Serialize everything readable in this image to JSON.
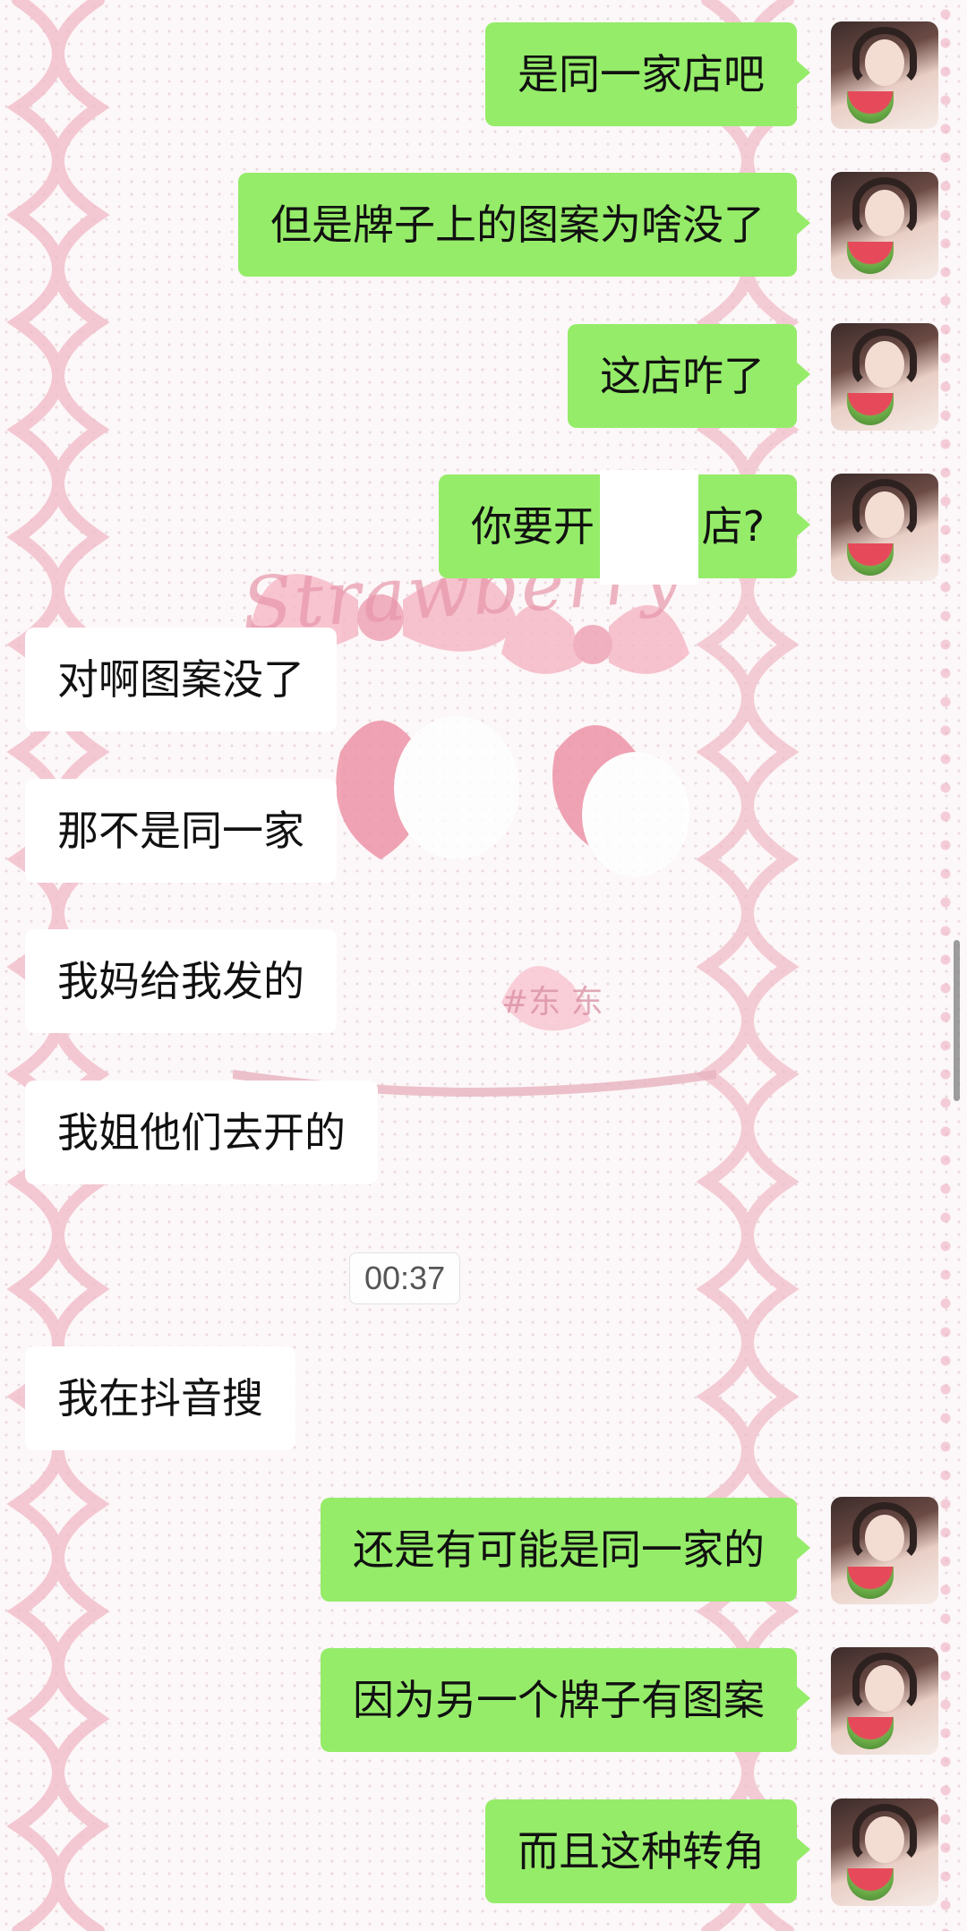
{
  "messages": [
    {
      "side": "out",
      "text": "是同一家店吧"
    },
    {
      "side": "out",
      "text": "但是牌子上的图案为啥没了"
    },
    {
      "side": "out",
      "text": "这店咋了"
    },
    {
      "side": "out",
      "text": "你要开"
    },
    {
      "side": "out",
      "text": "店?"
    },
    {
      "side": "in",
      "text": "对啊图案没了"
    },
    {
      "side": "in",
      "text": "那不是同一家"
    },
    {
      "side": "in",
      "text": "我妈给我发的"
    },
    {
      "side": "in",
      "text": "我姐他们去开的"
    },
    {
      "side": "in",
      "text": "我在抖音搜"
    },
    {
      "side": "out",
      "text": "还是有可能是同一家的"
    },
    {
      "side": "out",
      "text": "因为另一个牌子有图案"
    },
    {
      "side": "out",
      "text": "而且这种转角"
    }
  ],
  "timestamp": "00:37",
  "wallpaper": {
    "watermark": "Strawberry",
    "hashtag": "#东 东"
  },
  "icons": {
    "avatar": "user-avatar-icon"
  },
  "colors": {
    "outgoing_bubble": "#95ec69",
    "incoming_bubble": "#ffffff",
    "background": "#fcf7f8"
  }
}
